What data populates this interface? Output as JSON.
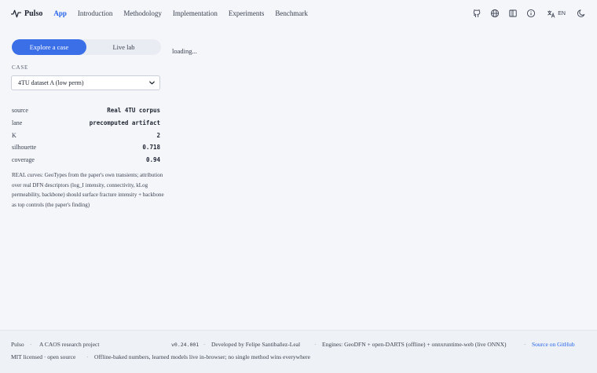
{
  "brand": {
    "name": "Pulso"
  },
  "nav": [
    {
      "label": "App",
      "active": true
    },
    {
      "label": "Introduction"
    },
    {
      "label": "Methodology"
    },
    {
      "label": "Implementation"
    },
    {
      "label": "Experiments"
    },
    {
      "label": "Benchmark"
    }
  ],
  "header_icons": [
    "github-icon",
    "globe-icon",
    "book-icon",
    "info-icon",
    "translate-icon",
    "moon-icon"
  ],
  "lang": {
    "label": "EN"
  },
  "tabs": {
    "explore": "Explore a case",
    "live": "Live lab"
  },
  "case": {
    "section_label": "CASE",
    "selected": "4TU dataset A (low perm)"
  },
  "stats": [
    {
      "key": "source",
      "value": "Real 4TU corpus"
    },
    {
      "key": "lane",
      "value": "precomputed artifact"
    },
    {
      "key": "K",
      "value": "2"
    },
    {
      "key": "silhouette",
      "value": "0.718"
    },
    {
      "key": "coverage",
      "value": "0.94"
    }
  ],
  "note": "REAL curves: GeoTypes from the paper's own transients; attribution over real DFN descriptors (log_I intensity, connectivity, kLog permeability, backbone) should surface fracture intensity + backbone as top controls (the paper's finding)",
  "main": {
    "loading": "loading..."
  },
  "footer": {
    "brand": "Pulso",
    "tagline": "A CAOS research project",
    "version": "v0.24.001",
    "developer": "Developed by Felipe Santibañez-Leal",
    "engines": "Engines: GeoDFN + open-DARTS (offline) + onnxruntime-web (live ONNX)",
    "source_link": "Source on GitHub",
    "license": "MIT licensed · open source",
    "disclaimer": "Offline-baked numbers, learned models live in-browser; no single method wins everywhere"
  },
  "colors": {
    "accent": "#3b6fe8",
    "link": "#2563eb",
    "background": "#f4f6fa"
  }
}
